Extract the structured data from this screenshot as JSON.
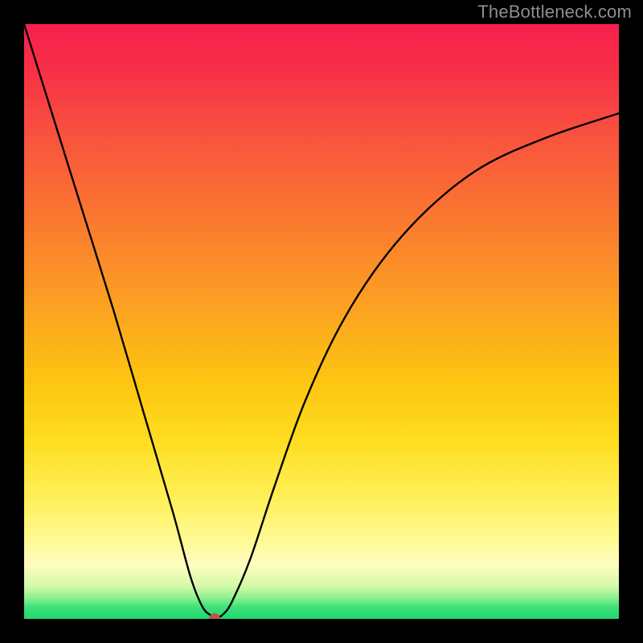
{
  "watermark": "TheBottleneck.com",
  "chart_data": {
    "type": "line",
    "title": "",
    "xlabel": "",
    "ylabel": "",
    "xlim": [
      0,
      100
    ],
    "ylim": [
      0,
      100
    ],
    "grid": false,
    "legend": false,
    "series": [
      {
        "name": "bottleneck-curve",
        "x": [
          0,
          5,
          10,
          15,
          20,
          25,
          28,
          30,
          31.5,
          32,
          33.5,
          35,
          38,
          42,
          47,
          53,
          60,
          68,
          77,
          88,
          100
        ],
        "y": [
          100,
          84,
          68,
          52,
          35,
          18,
          7,
          2,
          0.5,
          0,
          0.8,
          3,
          10,
          22,
          36,
          49,
          60,
          69,
          76,
          81,
          85
        ]
      }
    ],
    "annotations": [
      {
        "name": "minimum-marker",
        "x": 32,
        "y": 0,
        "marker": "dot",
        "color": "#c15248"
      }
    ],
    "background_gradient": {
      "type": "vertical",
      "stops": [
        {
          "pos": 0.0,
          "color": "#f71f4d"
        },
        {
          "pos": 0.32,
          "color": "#fa7631"
        },
        {
          "pos": 0.6,
          "color": "#fdc511"
        },
        {
          "pos": 0.87,
          "color": "#fffa95"
        },
        {
          "pos": 1.0,
          "color": "#1fd86f"
        }
      ]
    }
  }
}
